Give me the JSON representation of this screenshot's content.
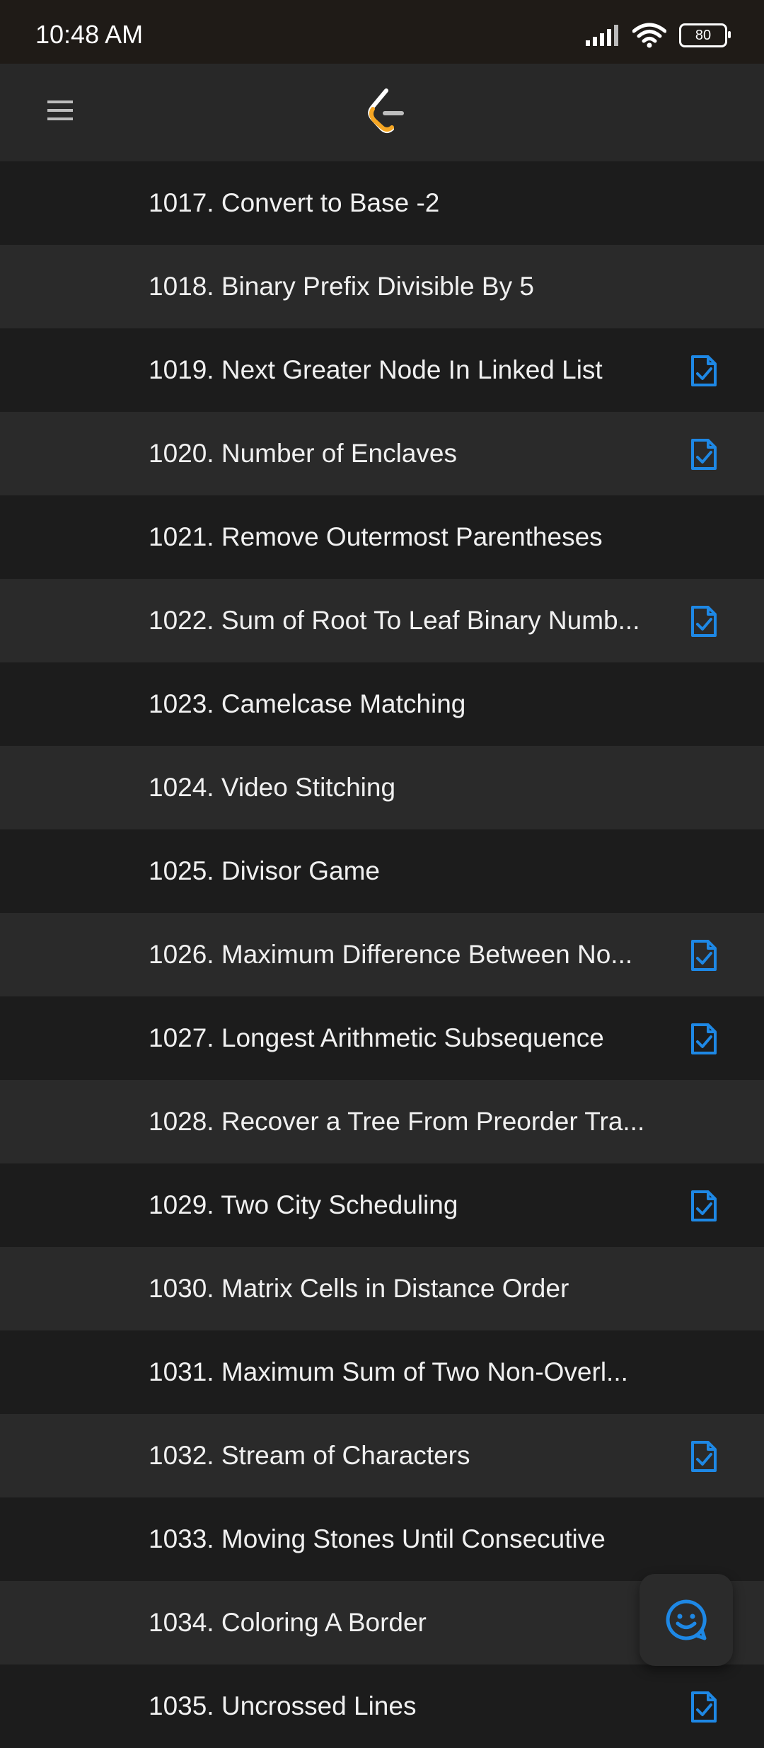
{
  "status": {
    "time": "10:48 AM",
    "battery": "80"
  },
  "colors": {
    "accent": "#1e88e5",
    "logo_orange": "#f5a623"
  },
  "icons": {
    "menu": "hamburger-menu-icon",
    "logo": "leetcode-logo-icon",
    "solved": "solved-document-check-icon",
    "feedback": "smiley-chat-icon"
  },
  "problems": [
    {
      "title": "1017. Convert to Base -2",
      "solved": false
    },
    {
      "title": "1018. Binary Prefix Divisible By 5",
      "solved": false
    },
    {
      "title": "1019. Next Greater Node In Linked List",
      "solved": true
    },
    {
      "title": "1020. Number of Enclaves",
      "solved": true
    },
    {
      "title": "1021. Remove Outermost Parentheses",
      "solved": false
    },
    {
      "title": "1022. Sum of Root To Leaf Binary Numb...",
      "solved": true
    },
    {
      "title": "1023. Camelcase Matching",
      "solved": false
    },
    {
      "title": "1024. Video Stitching",
      "solved": false
    },
    {
      "title": "1025. Divisor Game",
      "solved": false
    },
    {
      "title": "1026. Maximum Difference Between No...",
      "solved": true
    },
    {
      "title": "1027. Longest Arithmetic Subsequence",
      "solved": true
    },
    {
      "title": "1028. Recover a Tree From Preorder Tra...",
      "solved": false
    },
    {
      "title": "1029. Two City Scheduling",
      "solved": true
    },
    {
      "title": "1030. Matrix Cells in Distance Order",
      "solved": false
    },
    {
      "title": "1031. Maximum Sum of Two Non-Overl...",
      "solved": false
    },
    {
      "title": "1032. Stream of Characters",
      "solved": true
    },
    {
      "title": "1033. Moving Stones Until Consecutive",
      "solved": false
    },
    {
      "title": "1034. Coloring A Border",
      "solved": false
    },
    {
      "title": "1035. Uncrossed Lines",
      "solved": true
    }
  ]
}
